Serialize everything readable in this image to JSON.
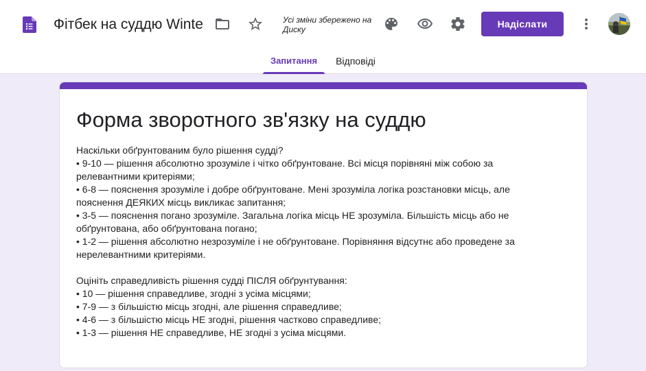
{
  "header": {
    "doc_title": "Фітбек на суддю Winte",
    "save_status": "Усі зміни збережено на Диску",
    "send_label": "Надіслати",
    "icons": [
      "forms-logo-icon",
      "folder-icon",
      "star-icon",
      "palette-icon",
      "eye-icon",
      "gear-icon",
      "more-vert-icon"
    ]
  },
  "tabs": [
    {
      "label": "Запитання",
      "active": true
    },
    {
      "label": "Відповіді",
      "active": false
    }
  ],
  "form": {
    "title": "Форма зворотного зв'язку на суддю",
    "description": "Наскільки обґрунтованим було рішення судді?\n• 9-10 — рішення абсолютно зрозуміле і чітко обґрунтоване. Всі місця порівняні між собою за релевантними критеріями;\n• 6-8 — пояснення зрозуміле і добре обґрунтоване. Мені зрозуміла логіка розстановки місць, але пояснення ДЕЯКИХ місць викликає запитання;\n• 3-5 — пояснення погано зрозуміле. Загальна логіка місць НЕ зрозуміла. Більшість місць або не обґрунтована, або обґрунтована погано;\n• 1-2 — рішення абсолютно незрозуміле і не обґрунтоване. Порівняння відсутнє або проведене за нерелевантними критеріями.\n\nОцініть справедливість рішення судді ПІСЛЯ обґрунтування:\n• 10 — рішення справедливе, згодні з усіма місцями;\n• 7-9 — з більшістю місць згодні, але рішення справедливе;\n• 4-6 — з більшістю місць НЕ згодні, рішення частково справедливе;\n• 1-3 — рішення НЕ справедливе, НЕ згодні з усіма місцями."
  },
  "colors": {
    "accent": "#673ab7",
    "background": "#f0ebf8"
  }
}
